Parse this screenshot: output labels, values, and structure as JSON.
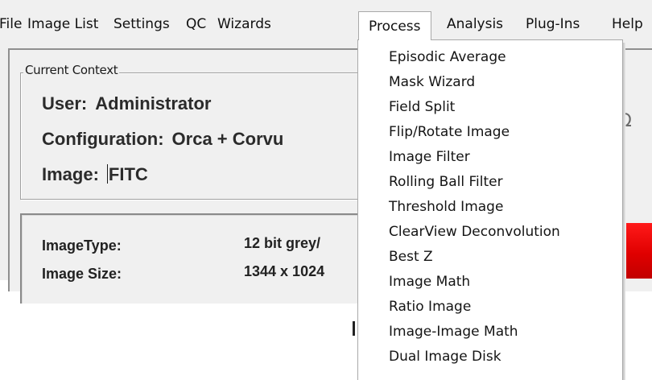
{
  "menubar": {
    "items": [
      {
        "label": "File"
      },
      {
        "label": "Image List"
      },
      {
        "label": "Settings"
      },
      {
        "label": "QC"
      },
      {
        "label": "Wizards"
      },
      {
        "label": "Process"
      },
      {
        "label": "Analysis"
      },
      {
        "label": "Plug-Ins"
      },
      {
        "label": "Help"
      }
    ],
    "open_menu": "Process"
  },
  "context": {
    "title": "Current Context",
    "user_key": "User:",
    "user_value": "Administrator",
    "config_key": "Configuration:",
    "config_value": "Orca + Corvu",
    "image_key": "Image:",
    "image_value": "FITC"
  },
  "info": {
    "rows": [
      {
        "label": "ImageType:",
        "value": "12 bit grey/"
      },
      {
        "label": "Image Size:",
        "value": "1344 x 1024"
      }
    ]
  },
  "process_menu": {
    "items": [
      {
        "label": "Episodic Average"
      },
      {
        "label": "Mask Wizard"
      },
      {
        "label": "Field Split"
      },
      {
        "label": "Flip/Rotate Image"
      },
      {
        "label": "Image Filter"
      },
      {
        "label": "Rolling Ball Filter"
      },
      {
        "label": "Threshold Image"
      },
      {
        "label": "ClearView Deconvolution"
      },
      {
        "label": "Best Z"
      },
      {
        "label": "Image Math"
      },
      {
        "label": "Ratio Image"
      },
      {
        "label": "Image-Image Math"
      },
      {
        "label": "Dual Image Disk"
      }
    ]
  },
  "partial_icon": "Ω",
  "colors": {
    "menubar_bg": "#f0f0f0",
    "window_bg": "#f0f0f0",
    "dropdown_bg": "#ffffff",
    "red_widget": "#e00000"
  }
}
